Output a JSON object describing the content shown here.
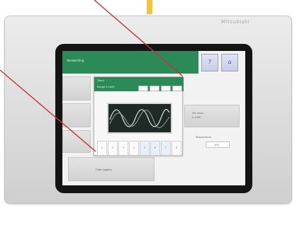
{
  "device": {
    "brand": "Mitsubishi",
    "accent_color": "#2b8a57",
    "callout_color": "#c8323a",
    "indicator_color": "#f2c43a"
  },
  "screen": {
    "title": "Handwriting",
    "nav": [
      {
        "icon": "info-icon",
        "glyph": "?"
      },
      {
        "icon": "home-icon",
        "glyph": "⌂"
      }
    ],
    "right_panel": {
      "line1": "Set value",
      "line2": "0-1000"
    },
    "small_panel_label": "Temperature",
    "small_panel_value": "100",
    "bottom_button_label": "Data logging"
  },
  "popup": {
    "name": "Trend",
    "range": "Range 0-1000",
    "tabs": [
      "",
      "",
      "",
      ""
    ],
    "keys": [
      "1",
      "2",
      "3",
      "4",
      "5",
      "6",
      "7",
      "8"
    ],
    "highlighted_keys": [
      4,
      5,
      6
    ]
  }
}
